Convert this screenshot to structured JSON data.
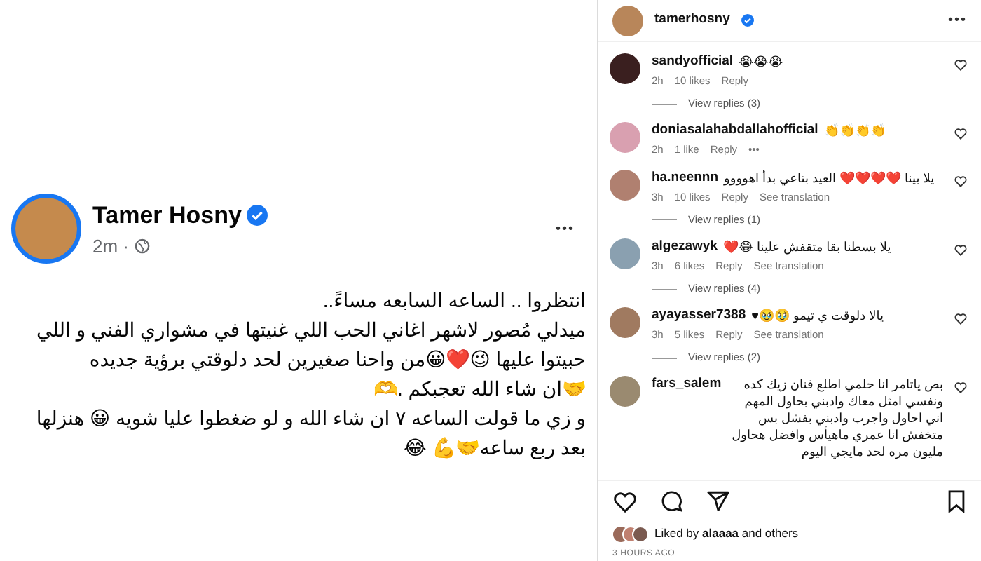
{
  "post": {
    "author": "Tamer Hosny",
    "verified": true,
    "time": "2m ·",
    "more": "•••",
    "lines": [
      "انتظروا .. الساعه السابعه مساءً..",
      "ميدلي مُصور لاشهر اغاني الحب اللي غنيتها في مشواري الفني  و اللي",
      "حبيتوا عليها 😉❤️😀من واحنا صغيرين لحد دلوقتي برؤية جديده",
      "🤝ان شاء الله تعجبكم .🫶",
      "و زي ما قولت الساعه ٧  ان شاء الله و لو ضغطوا عليا شويه 😀 هنزلها",
      "بعد ربع ساعه🤝💪 😂"
    ]
  },
  "panel": {
    "username": "tamerhosny",
    "verified": true,
    "more": "•••",
    "comments": [
      {
        "user": "sandyofficial",
        "text": "😭😭😭",
        "time": "2h",
        "likes": "10 likes",
        "reply": "Reply",
        "view_replies": "View replies (3)"
      },
      {
        "user": "doniasalahabdallahofficial",
        "text": "👏👏👏👏",
        "time": "2h",
        "likes": "1 like",
        "reply": "Reply",
        "more": "•••"
      },
      {
        "user": "ha.neennn",
        "text": "يلا بينا ❤️❤️❤️❤️ العيد بتاعي بدأ اهوووو",
        "time": "3h",
        "likes": "10 likes",
        "reply": "Reply",
        "translation": "See translation",
        "view_replies": "View replies (1)"
      },
      {
        "user": "algezawyk",
        "text": "يلا بسطنا بقا متقفش علينا 😂❤️",
        "time": "3h",
        "likes": "6 likes",
        "reply": "Reply",
        "translation": "See translation",
        "view_replies": "View replies (4)"
      },
      {
        "user": "ayayasser7388",
        "text": "يالا دلوقت ي تيمو 🥹🥹♥",
        "time": "3h",
        "likes": "5 likes",
        "reply": "Reply",
        "translation": "See translation",
        "view_replies": "View replies (2)"
      },
      {
        "user": "fars_salem",
        "text": "بص ياتامر انا حلمي اطلع فنان زيك كده ونفسي امثل معاك وادبني بحاول المهم اني احاول واجرب وادبني بفشل بس متخفش انا عمري ماهيأس وافضل هحاول مليون مره لحد مايجي اليوم"
      }
    ],
    "liked_by": "Liked by **alaaaa** and others",
    "ago": "3 HOURS AGO"
  }
}
